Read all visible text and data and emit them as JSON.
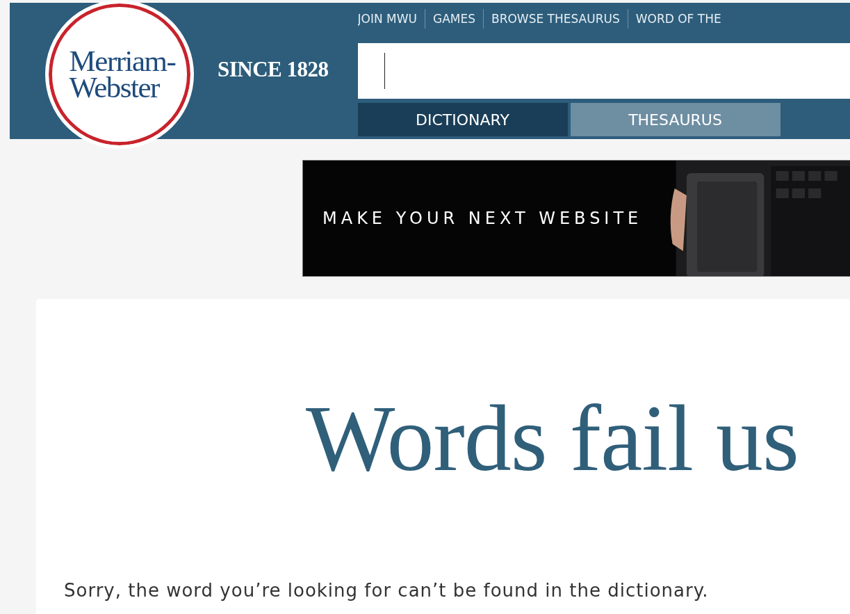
{
  "header": {
    "logo": {
      "line_1": "Merriam-",
      "line_2": "Webster"
    },
    "tagline": "SINCE 1828",
    "nav_links": [
      "JOIN MWU",
      "GAMES",
      "BROWSE THESAURUS",
      "WORD OF THE"
    ],
    "tabs": [
      {
        "label": "DICTIONARY",
        "selected": true
      },
      {
        "label": "THESAURUS",
        "selected": false
      }
    ]
  },
  "ad_banner": {
    "kind": "picture",
    "headline": "MAKE YOUR NEXT WEBSITE"
  },
  "message": {
    "title": "Words fail us",
    "text": "Sorry, the word you’re looking for can’t be found in the dictionary."
  }
}
